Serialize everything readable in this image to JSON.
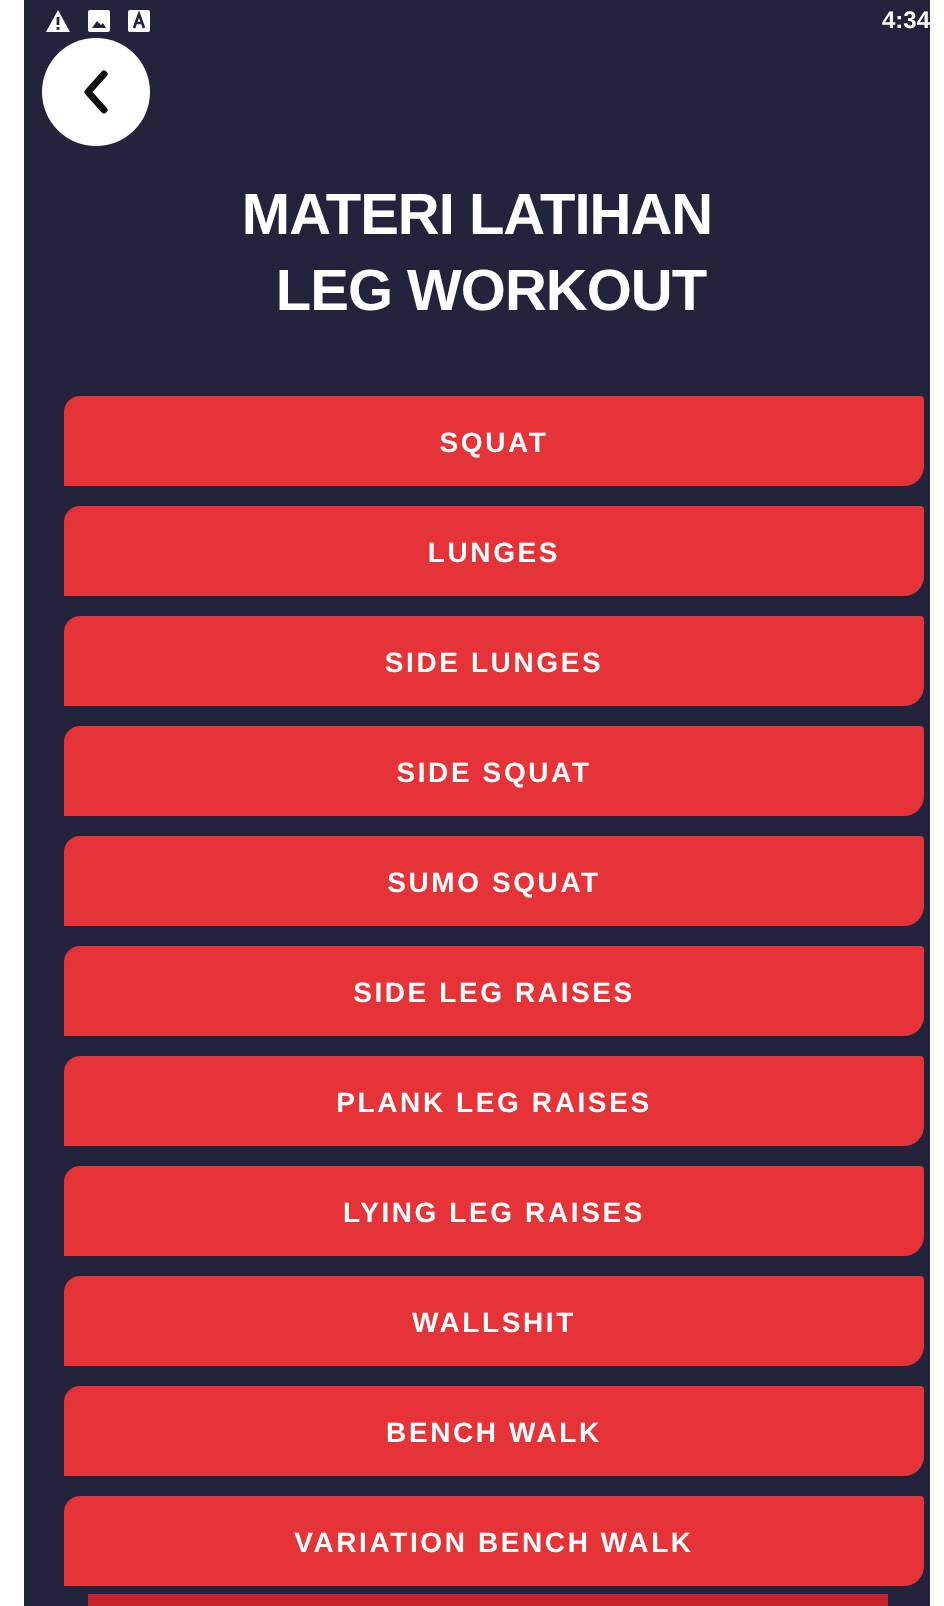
{
  "status_bar": {
    "time": "4:34"
  },
  "title_lines": [
    "MATERI LATIHAN",
    "LEG WORKOUT"
  ],
  "exercises": [
    "SQUAT",
    "LUNGES",
    "SIDE LUNGES",
    "SIDE SQUAT",
    "SUMO SQUAT",
    "SIDE LEG RAISES",
    "PLANK LEG RAISES",
    "LYING LEG RAISES",
    "WALLSHIT",
    "BENCH WALK",
    "VARIATION BENCH WALK"
  ]
}
